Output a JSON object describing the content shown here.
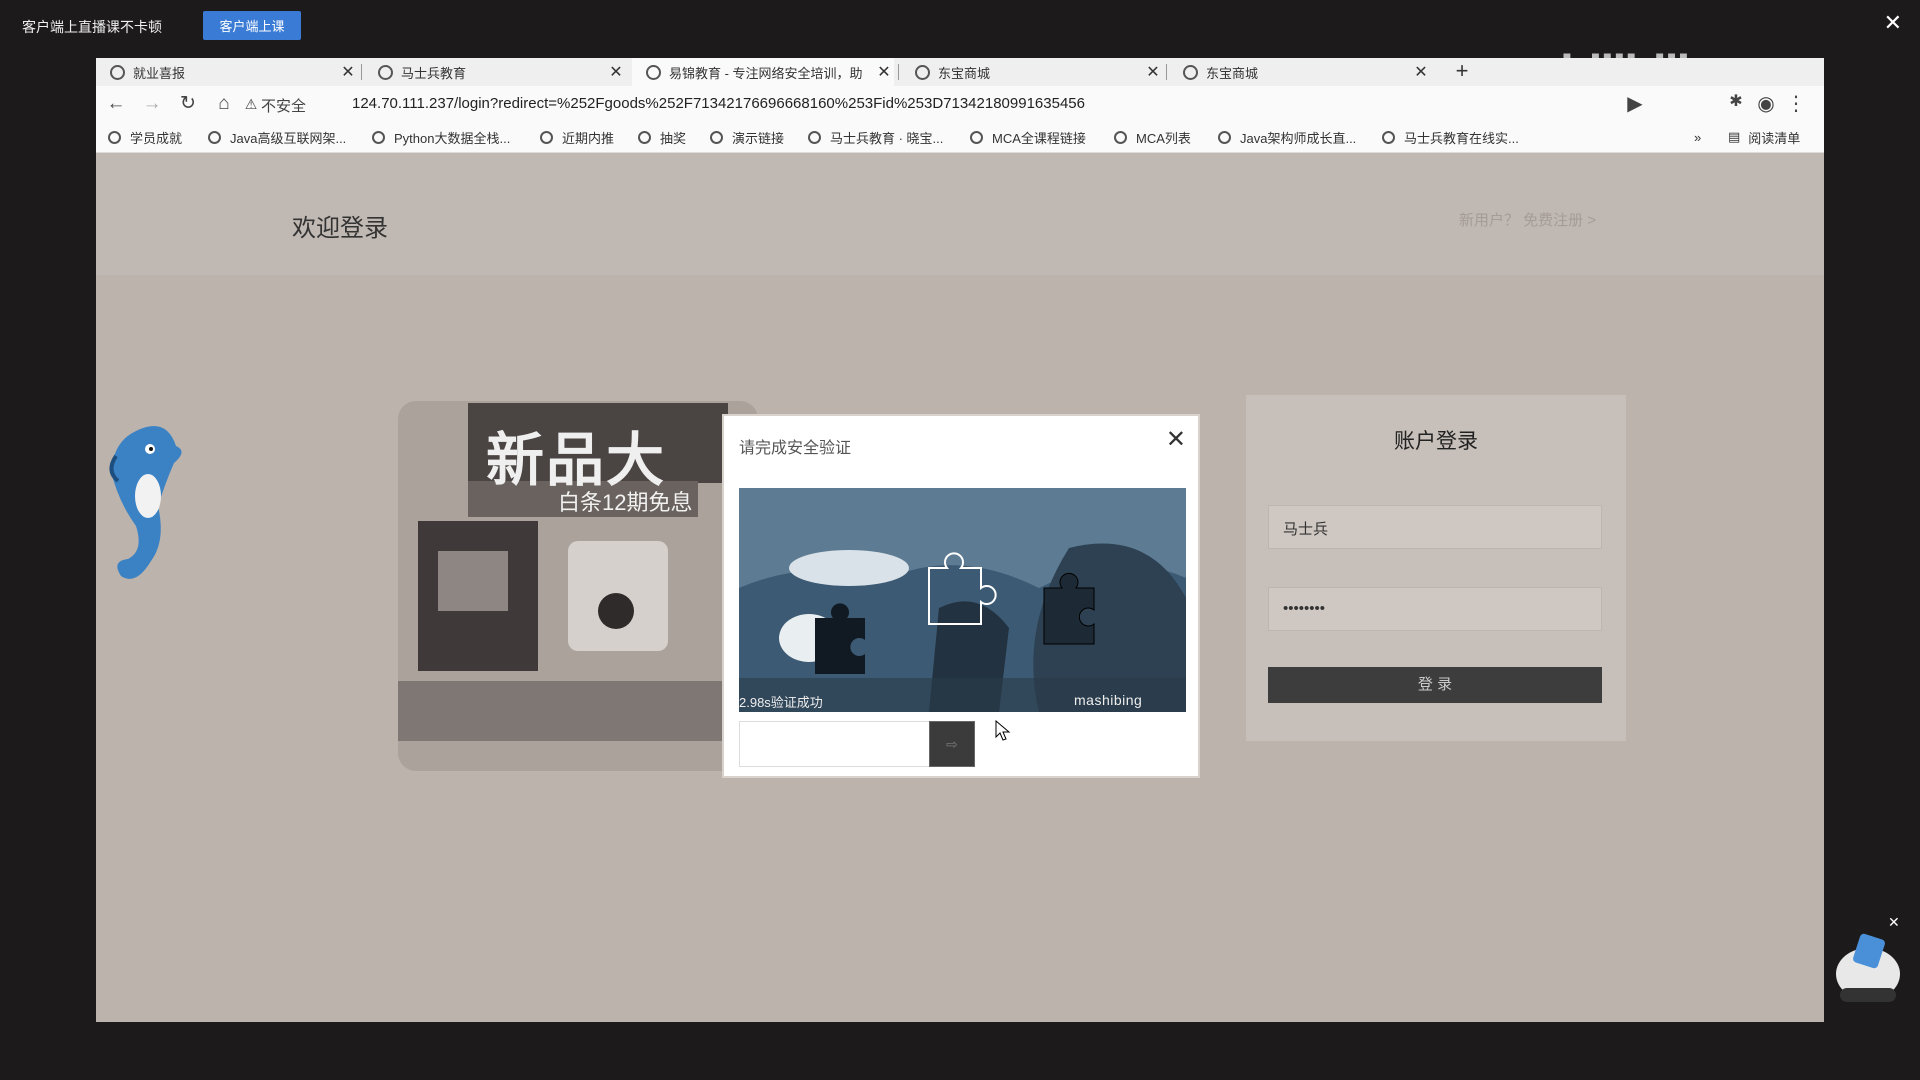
{
  "topbar": {
    "promo_text": "客户端上直播课不卡顿",
    "promo_button": "客户端上课",
    "close_glyph": "✕"
  },
  "watermark": {
    "logo": "bilibili"
  },
  "tabs": [
    {
      "title": "就业喜报",
      "active": false
    },
    {
      "title": "马士兵教育",
      "active": false
    },
    {
      "title": "易锦教育 - 专注网络安全培训，助",
      "active": true
    },
    {
      "title": "东宝商城",
      "active": false
    },
    {
      "title": "东宝商城",
      "active": false
    }
  ],
  "tab_close_glyph": "✕",
  "new_tab_glyph": "+",
  "address_bar": {
    "security_label": "不安全",
    "url": "124.70.111.237/login?redirect=%252Fgoods%252F71342176696668160%253Fid%253D71342180991635456"
  },
  "bookmarks": [
    "学员成就",
    "Java高级互联网架...",
    "Python大数据全栈...",
    "近期内推",
    "抽奖",
    "演示链接",
    "马士兵教育 · 晓宝...",
    "MCA全课程链接",
    "MCA列表",
    "Java架构师成长直...",
    "马士兵教育在线实..."
  ],
  "bookmarks_more": "»",
  "reading_list": "阅读清单",
  "page": {
    "welcome": "欢迎登录",
    "header_link": "新用户？ 免费注册 >",
    "banner_text_1": "新品大",
    "banner_text_2": "白条12期免息"
  },
  "login": {
    "title": "账户登录",
    "username": "马士兵",
    "password": "••••••••",
    "submit": "登 录"
  },
  "captcha": {
    "title": "请完成安全验证",
    "close_glyph": "✕",
    "status": "2.98s验证成功",
    "brand": "mashibing",
    "knob_glyph": "⇨"
  },
  "colors": {
    "desktop": "#1c1a1a",
    "promo_button": "#3a7bd5",
    "page_bg": "#bbb3ac",
    "login_button": "#3d3d3d"
  }
}
